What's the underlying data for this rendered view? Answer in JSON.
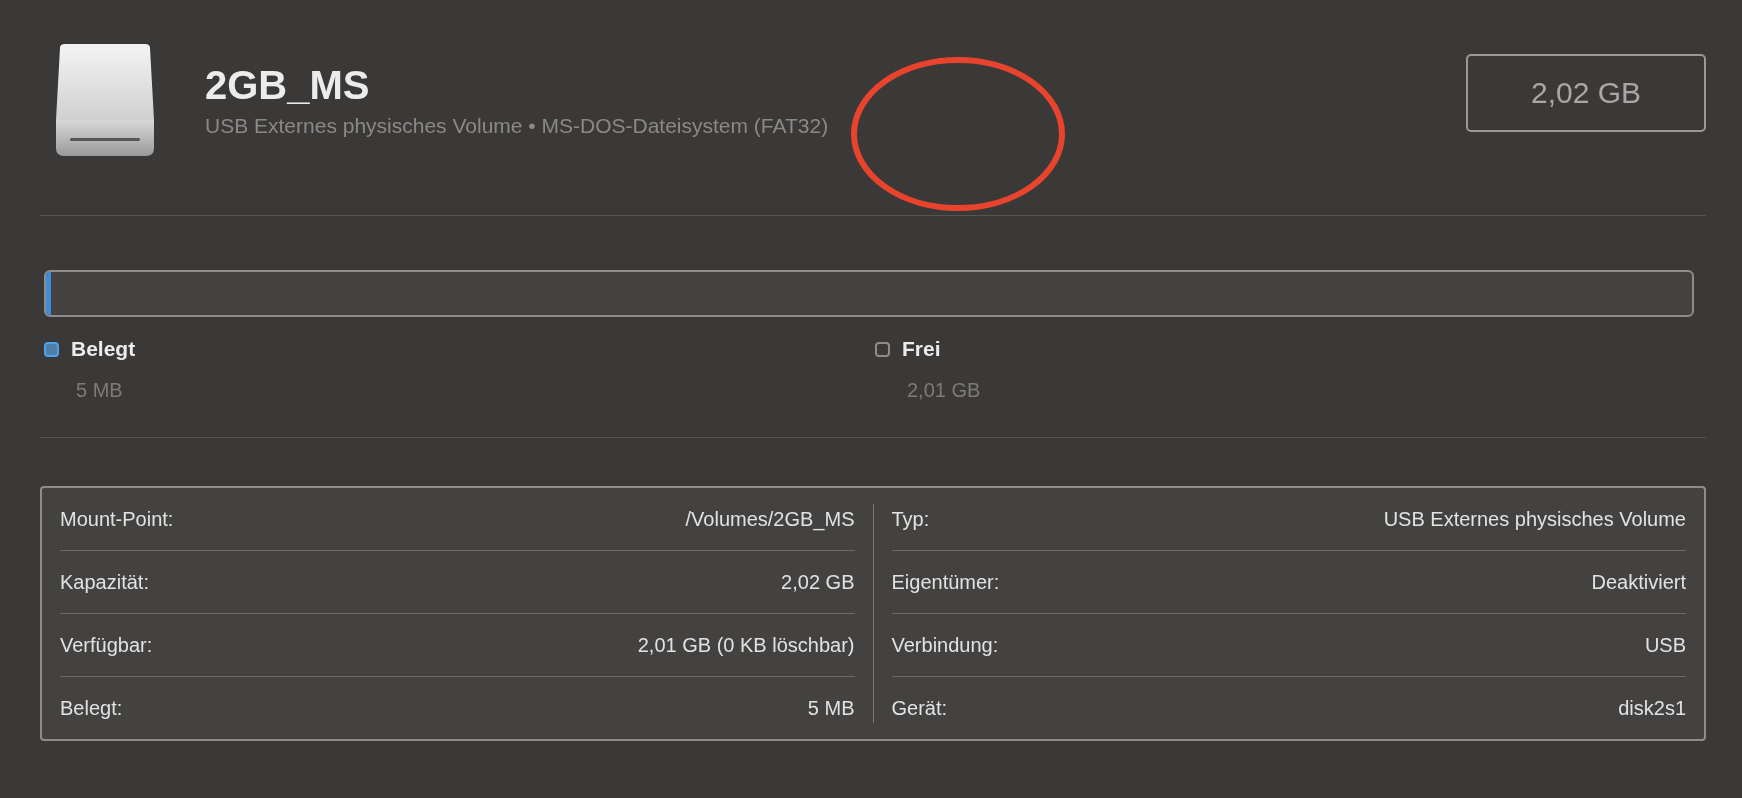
{
  "volume": {
    "name": "2GB_MS",
    "description": "USB Externes physisches Volume • MS-DOS-Dateisystem (FAT32)",
    "size": "2,02 GB"
  },
  "annotation": {
    "kind": "ellipse"
  },
  "usage": {
    "level": 0.003
  },
  "legend": [
    {
      "label": "Belegt",
      "value": "5 MB",
      "color": "#4f7fa8"
    },
    {
      "label": "Frei",
      "value": "2,01 GB",
      "color": "#3a3938"
    }
  ],
  "info_left": [
    {
      "label": "Mount-Point:",
      "value": "/Volumes/2GB_MS"
    },
    {
      "label": "Kapazität:",
      "value": "2,02 GB"
    },
    {
      "label": "Verfügbar:",
      "value": "2,01 GB (0 KB löschbar)"
    },
    {
      "label": "Belegt:",
      "value": "5 MB"
    }
  ],
  "info_right": [
    {
      "label": "Typ:",
      "value": "USB Externes physisches Volume"
    },
    {
      "label": "Eigentümer:",
      "value": "Deaktiviert"
    },
    {
      "label": "Verbindung:",
      "value": "USB"
    },
    {
      "label": "Gerät:",
      "value": "disk2s1"
    }
  ]
}
